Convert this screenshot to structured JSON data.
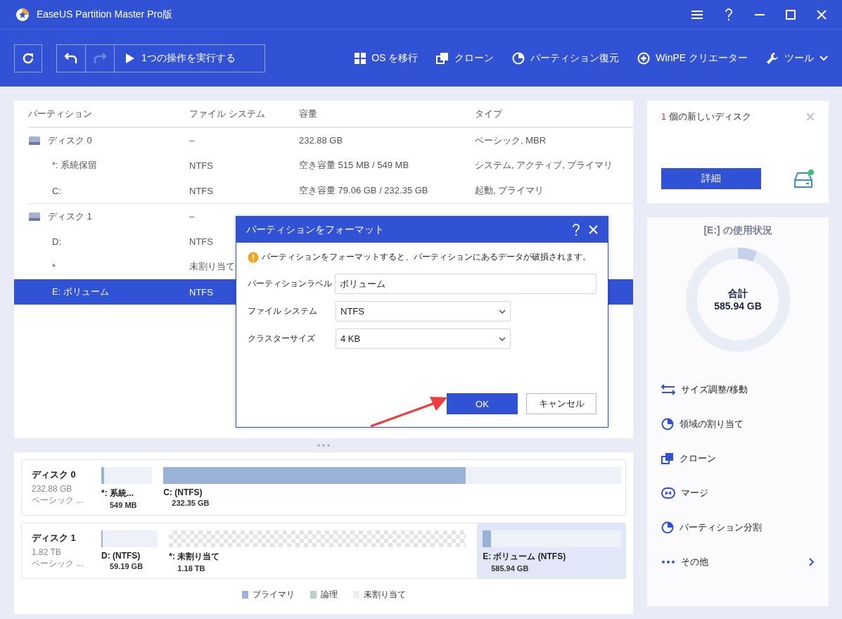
{
  "window": {
    "title": "EaseUS Partition Master Pro版"
  },
  "toolbar": {
    "run_label": "1つの操作を実行する",
    "redo_disabled": true,
    "items": [
      {
        "kind": "windows",
        "label": "OS を移行"
      },
      {
        "kind": "clone",
        "label": "クローン"
      },
      {
        "kind": "pie",
        "label": "パーティション復元"
      },
      {
        "kind": "plus",
        "label": "WinPE クリエーター"
      },
      {
        "kind": "tools",
        "label": "ツール"
      }
    ]
  },
  "table": {
    "columns": [
      "パーティション",
      "ファイル システム",
      "容量",
      "タイプ"
    ],
    "rows": [
      {
        "kind": "disk",
        "selected": false,
        "cells": [
          "ディスク 0",
          "–",
          "232.88 GB",
          "ベーシック, MBR"
        ]
      },
      {
        "kind": "partition",
        "selected": false,
        "cells": [
          "*: 系統保留",
          "NTFS",
          "空き容量 515 MB / 549 MB",
          "システム, アクティブ, プライマリ"
        ]
      },
      {
        "kind": "partition",
        "selected": false,
        "cells": [
          "C:",
          "NTFS",
          "空き容量 79.06 GB / 232.35 GB",
          "起動, プライマリ"
        ]
      },
      {
        "kind": "disk",
        "selected": false,
        "cells": [
          "ディスク 1",
          "–"
        ]
      },
      {
        "kind": "partition",
        "selected": false,
        "cells": [
          "D:",
          "NTFS"
        ]
      },
      {
        "kind": "partition",
        "selected": false,
        "cells": [
          "*",
          "未割り当て"
        ]
      },
      {
        "kind": "partition",
        "selected": true,
        "cells": [
          "E: ボリューム",
          "NTFS"
        ]
      }
    ]
  },
  "dialog": {
    "title": "パーティションをフォーマット",
    "warning": "パーティションをフォーマットすると、パーティションにあるデータが破損されます。",
    "fields": [
      {
        "kind": "text",
        "label": "パーティションラベル",
        "value": "ボリューム"
      },
      {
        "kind": "select",
        "label": "ファイル システム",
        "value": "NTFS"
      },
      {
        "kind": "select",
        "label": "クラスターサイズ",
        "value": "4 KB"
      }
    ],
    "ok": "OK",
    "cancel": "キャンセル"
  },
  "disk_map": [
    {
      "name": "ディスク 0",
      "size": "232.88 GB",
      "type": "ベーシック ...",
      "partitions": [
        {
          "kind": "primary",
          "label": "*: 系統...",
          "size": "549 MB",
          "level": 0.05,
          "selected": false
        },
        {
          "kind": "primary",
          "label": "C: (NTFS)",
          "size": "232.35 GB",
          "level": 0.66,
          "selected": false
        }
      ]
    },
    {
      "name": "ディスク 1",
      "size": "1.82 TB",
      "type": "ベーシック ...",
      "partitions": [
        {
          "kind": "primary",
          "label": "D: (NTFS)",
          "size": "59.19 GB",
          "level": 0.02,
          "selected": false
        },
        {
          "kind": "unallocated",
          "label": "*: 未割り当て",
          "size": "1.18 TB",
          "selected": false
        },
        {
          "kind": "primary",
          "label": "E: ボリューム (NTFS)",
          "size": "585.94 GB",
          "level": 0.06,
          "selected": true
        }
      ]
    }
  ],
  "legend": [
    {
      "label": "プライマリ",
      "color": "#9ab2d6"
    },
    {
      "label": "論理",
      "color": "#b5d3c0"
    },
    {
      "label": "未割り当て",
      "color": "#eeeeee"
    }
  ],
  "new_disk": {
    "count": "1",
    "text": "個の新しいディスク",
    "button": "詳細"
  },
  "usage": {
    "title": "[E:] の使用状況",
    "total_label": "合計",
    "total": "585.94 GB",
    "level": 0.06
  },
  "actions": [
    {
      "kind": "resize",
      "label": "サイズ調整/移動"
    },
    {
      "kind": "pie",
      "label": "領域の割り当て"
    },
    {
      "kind": "clone",
      "label": "クローン"
    },
    {
      "kind": "merge",
      "label": "マージ"
    },
    {
      "kind": "pie",
      "label": "パーティション分割"
    },
    {
      "kind": "more",
      "label": "その他"
    }
  ]
}
